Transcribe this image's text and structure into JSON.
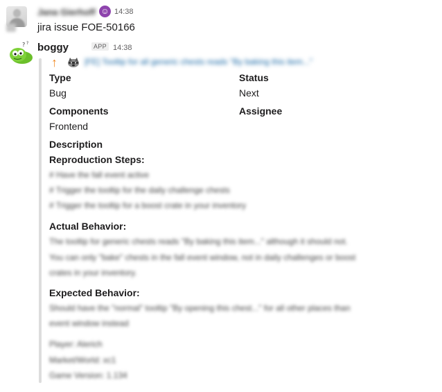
{
  "message1": {
    "sender": "Jana Gierhoff",
    "time": "14:38",
    "text": "jira issue FOE-50166"
  },
  "message2": {
    "sender": "boggy",
    "badge": "APP",
    "time": "14:38"
  },
  "issue": {
    "title": "[FE] Tooltip for all generic chests reads \"By baking this item...\"",
    "fields": {
      "type_label": "Type",
      "type_value": "Bug",
      "status_label": "Status",
      "status_value": "Next",
      "components_label": "Components",
      "components_value": "Frontend",
      "assignee_label": "Assignee",
      "description_label": "Description"
    },
    "reproduction_label": "Reproduction Steps:",
    "reproduction_lines": [
      "# Have the fall event active",
      "# Trigger the tooltip for the daily challenge chests",
      "# Trigger the tooltip for a boost crate in your inventory"
    ],
    "actual_label": "Actual Behavior:",
    "actual_lines": [
      "The tooltip for generic chests reads \"By baking this item...\" although it should not.",
      "You can only \"bake\" chests in the fall event window, not in daily challenges or boost",
      "crates in your inventory."
    ],
    "expected_label": "Expected Behavior:",
    "expected_lines": [
      "Should have the \"normal\" tooltip \"By opening this chest...\" for all other places than",
      "event window instead"
    ],
    "meta_lines": [
      "Player: Alerich",
      "Market/World: xc1",
      "Game Version: 1.134"
    ]
  }
}
